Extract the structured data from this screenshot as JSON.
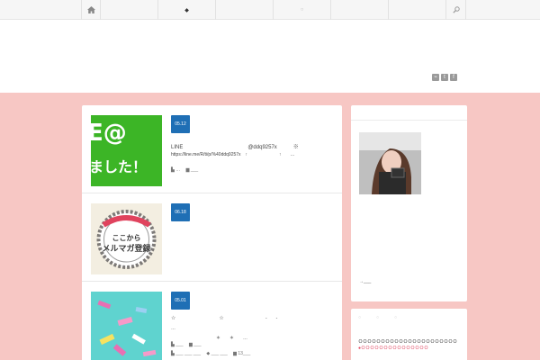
{
  "nav": {
    "items": [
      "◆",
      "○"
    ],
    "home_icon": "home-icon",
    "search_icon": "search-icon"
  },
  "header": {
    "social": [
      "rss-icon",
      "twitter-icon",
      "facebook-icon"
    ]
  },
  "posts": [
    {
      "date": "05.12",
      "thumb_text": [
        "E@",
        "ました！"
      ],
      "line1": "LINE　　　　　　　　　　　　@ddq9257x　　　※",
      "line2": "https://line.me/R/ti/p/%40ddq9257x　↑　　　　　　　↑　　…",
      "meta": "▙ …　 ▆ ___"
    },
    {
      "date": "06.18",
      "thumb_text": [
        "ここから",
        "メルマガ登録"
      ],
      "line1": "☆　　　　　　　　☆",
      "line2": "　　　　　　　　　　＊　　＊　　…",
      "meta": "▙ ___ ___ ___　 ◆ ___ ___　 ▆ 13___"
    },
    {
      "date": "05.01",
      "thumb_text": [],
      "line1": "　　　　　　　　　　　　　　　　　　　　　-　　-",
      "line2": "…",
      "meta": "▙ ___　 ▆ ___"
    }
  ],
  "sidebar": {
    "link": "→___",
    "widget2_title": "○　○　○",
    "widget2_line1": "ＯＯＯＯＯＯＯＯＯＯＯＯＯＯＯＯＯＯＯＯＯＯ",
    "widget2_line2": "●ＯＯＯＯＯＯＯＯＯＯＯＯＯＯＯ"
  }
}
